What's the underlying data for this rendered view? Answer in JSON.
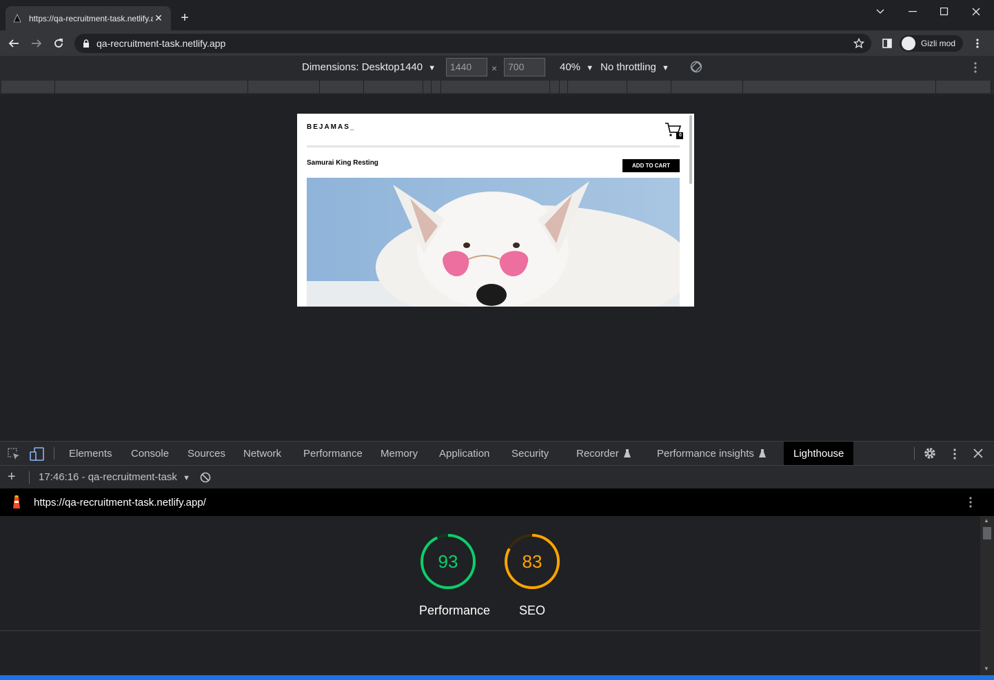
{
  "browser": {
    "tab_title": "https://qa-recruitment-task.netlify.app",
    "address": "qa-recruitment-task.netlify.app",
    "profile_label": "Gizli mod"
  },
  "device_toolbar": {
    "dimensions_label": "Dimensions: Desktop1440",
    "width": "1440",
    "height": "700",
    "times": "×",
    "zoom": "40%",
    "throttling": "No throttling"
  },
  "page": {
    "logo": "BEJAMAS_",
    "cart_count": "0",
    "product_title": "Samurai King Resting",
    "add_to_cart": "ADD TO CART"
  },
  "devtools": {
    "tabs": [
      "Elements",
      "Console",
      "Sources",
      "Network",
      "Performance",
      "Memory",
      "Application",
      "Security",
      "Recorder",
      "Performance insights",
      "Lighthouse"
    ],
    "report_label": "17:46:16 - qa-recruitment-task",
    "report_url": "https://qa-recruitment-task.netlify.app/"
  },
  "lighthouse": {
    "gauges": [
      {
        "label": "Performance",
        "score": "93",
        "fraction": 0.93,
        "color": "#0cce6b"
      },
      {
        "label": "SEO",
        "score": "83",
        "fraction": 0.83,
        "color": "#ffa400"
      }
    ]
  }
}
